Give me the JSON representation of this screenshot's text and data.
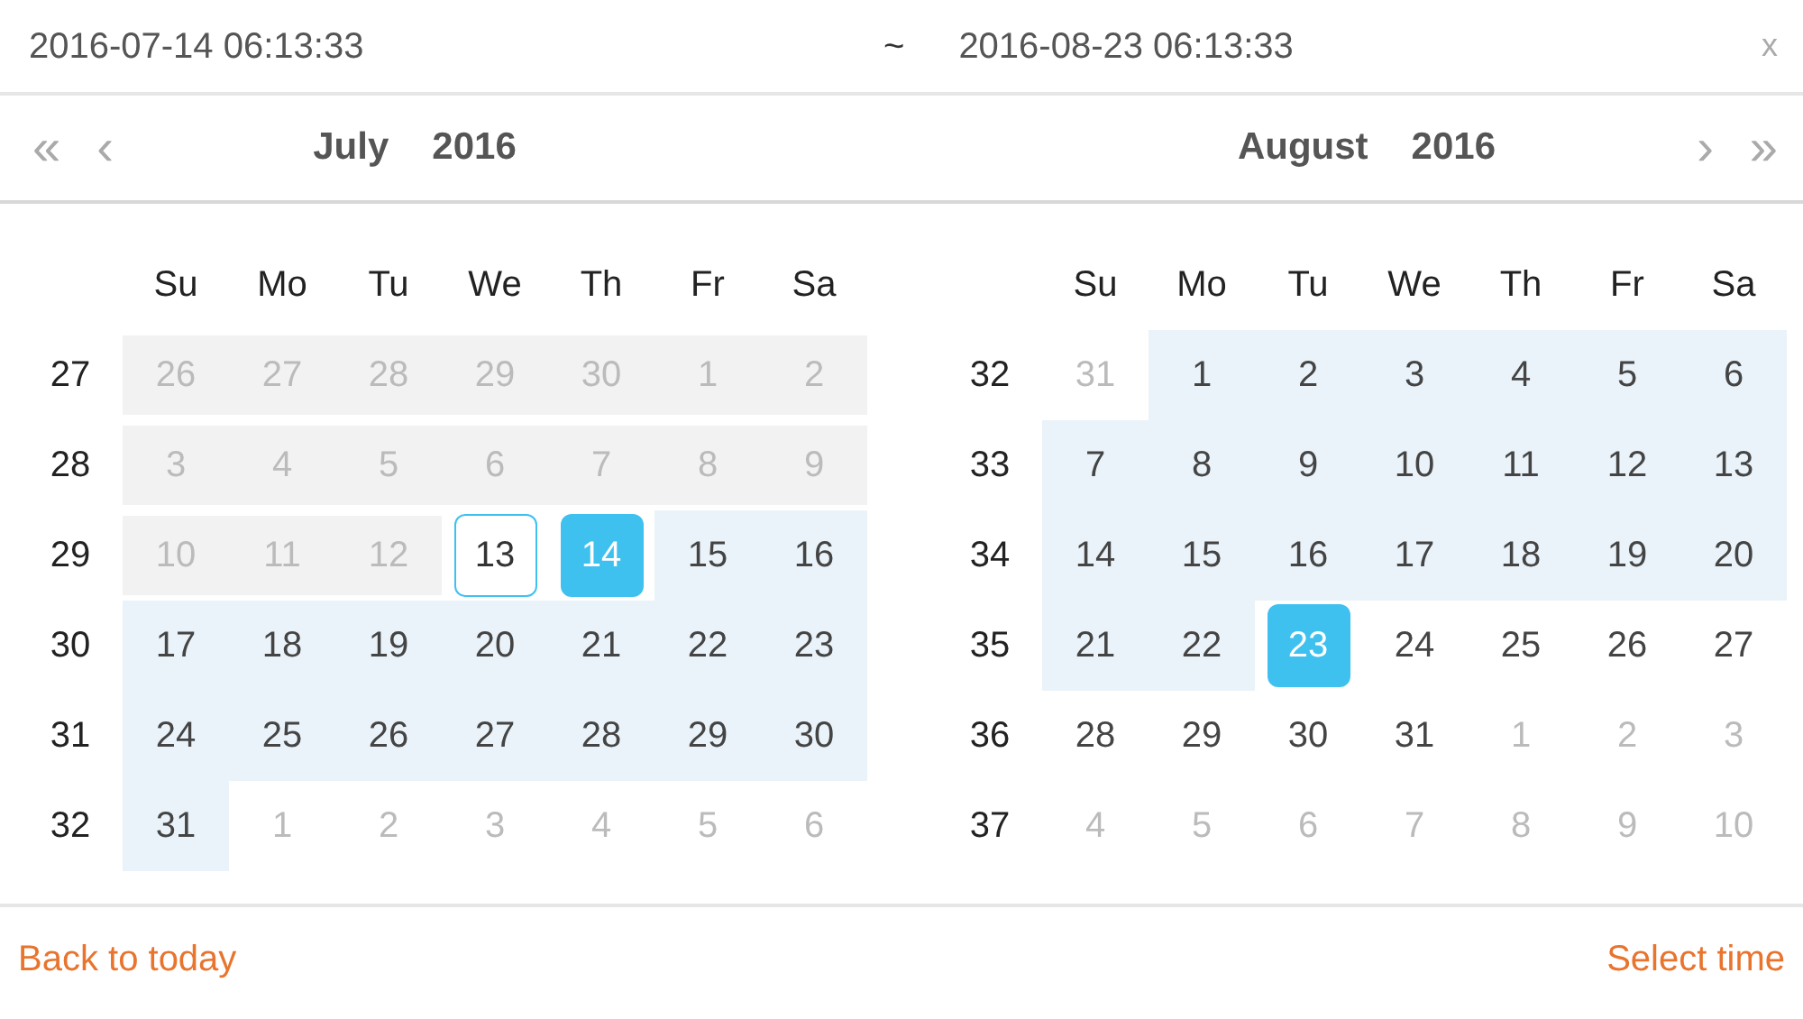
{
  "range": {
    "start": "2016-07-14 06:13:33",
    "separator": "~",
    "end": "2016-08-23 06:13:33",
    "close": "x"
  },
  "calendars": [
    {
      "nav": [
        {
          "label": "«",
          "kind": "prev-year"
        },
        {
          "label": "‹",
          "kind": "prev-month"
        }
      ],
      "month": "July",
      "year": "2016",
      "weekdays": [
        "Su",
        "Mo",
        "Tu",
        "We",
        "Th",
        "Fr",
        "Sa"
      ],
      "weeks": [
        {
          "number": "27",
          "days": [
            {
              "d": "26",
              "kind": "disabled",
              "in_range": false
            },
            {
              "d": "27",
              "kind": "disabled",
              "in_range": false
            },
            {
              "d": "28",
              "kind": "disabled",
              "in_range": false
            },
            {
              "d": "29",
              "kind": "disabled",
              "in_range": false
            },
            {
              "d": "30",
              "kind": "disabled",
              "in_range": false
            },
            {
              "d": "1",
              "kind": "disabled",
              "in_range": false
            },
            {
              "d": "2",
              "kind": "disabled",
              "in_range": false
            }
          ]
        },
        {
          "number": "28",
          "days": [
            {
              "d": "3",
              "kind": "disabled",
              "in_range": false
            },
            {
              "d": "4",
              "kind": "disabled",
              "in_range": false
            },
            {
              "d": "5",
              "kind": "disabled",
              "in_range": false
            },
            {
              "d": "6",
              "kind": "disabled",
              "in_range": false
            },
            {
              "d": "7",
              "kind": "disabled",
              "in_range": false
            },
            {
              "d": "8",
              "kind": "disabled",
              "in_range": false
            },
            {
              "d": "9",
              "kind": "disabled",
              "in_range": false
            }
          ]
        },
        {
          "number": "29",
          "days": [
            {
              "d": "10",
              "kind": "disabled",
              "in_range": false
            },
            {
              "d": "11",
              "kind": "disabled",
              "in_range": false
            },
            {
              "d": "12",
              "kind": "disabled",
              "in_range": false
            },
            {
              "d": "13",
              "kind": "today",
              "in_range": false
            },
            {
              "d": "14",
              "kind": "selected",
              "in_range": false
            },
            {
              "d": "15",
              "kind": "current",
              "in_range": true
            },
            {
              "d": "16",
              "kind": "current",
              "in_range": true
            }
          ]
        },
        {
          "number": "30",
          "days": [
            {
              "d": "17",
              "kind": "current",
              "in_range": true
            },
            {
              "d": "18",
              "kind": "current",
              "in_range": true
            },
            {
              "d": "19",
              "kind": "current",
              "in_range": true
            },
            {
              "d": "20",
              "kind": "current",
              "in_range": true
            },
            {
              "d": "21",
              "kind": "current",
              "in_range": true
            },
            {
              "d": "22",
              "kind": "current",
              "in_range": true
            },
            {
              "d": "23",
              "kind": "current",
              "in_range": true
            }
          ]
        },
        {
          "number": "31",
          "days": [
            {
              "d": "24",
              "kind": "current",
              "in_range": true
            },
            {
              "d": "25",
              "kind": "current",
              "in_range": true
            },
            {
              "d": "26",
              "kind": "current",
              "in_range": true
            },
            {
              "d": "27",
              "kind": "current",
              "in_range": true
            },
            {
              "d": "28",
              "kind": "current",
              "in_range": true
            },
            {
              "d": "29",
              "kind": "current",
              "in_range": true
            },
            {
              "d": "30",
              "kind": "current",
              "in_range": true
            }
          ]
        },
        {
          "number": "32",
          "days": [
            {
              "d": "31",
              "kind": "current",
              "in_range": true
            },
            {
              "d": "1",
              "kind": "other",
              "in_range": false
            },
            {
              "d": "2",
              "kind": "other",
              "in_range": false
            },
            {
              "d": "3",
              "kind": "other",
              "in_range": false
            },
            {
              "d": "4",
              "kind": "other",
              "in_range": false
            },
            {
              "d": "5",
              "kind": "other",
              "in_range": false
            },
            {
              "d": "6",
              "kind": "other",
              "in_range": false
            }
          ]
        }
      ]
    },
    {
      "nav": [
        {
          "label": "›",
          "kind": "next-month"
        },
        {
          "label": "»",
          "kind": "next-year"
        }
      ],
      "month": "August",
      "year": "2016",
      "weekdays": [
        "Su",
        "Mo",
        "Tu",
        "We",
        "Th",
        "Fr",
        "Sa"
      ],
      "weeks": [
        {
          "number": "32",
          "days": [
            {
              "d": "31",
              "kind": "other",
              "in_range": false
            },
            {
              "d": "1",
              "kind": "current",
              "in_range": true
            },
            {
              "d": "2",
              "kind": "current",
              "in_range": true
            },
            {
              "d": "3",
              "kind": "current",
              "in_range": true
            },
            {
              "d": "4",
              "kind": "current",
              "in_range": true
            },
            {
              "d": "5",
              "kind": "current",
              "in_range": true
            },
            {
              "d": "6",
              "kind": "current",
              "in_range": true
            }
          ]
        },
        {
          "number": "33",
          "days": [
            {
              "d": "7",
              "kind": "current",
              "in_range": true
            },
            {
              "d": "8",
              "kind": "current",
              "in_range": true
            },
            {
              "d": "9",
              "kind": "current",
              "in_range": true
            },
            {
              "d": "10",
              "kind": "current",
              "in_range": true
            },
            {
              "d": "11",
              "kind": "current",
              "in_range": true
            },
            {
              "d": "12",
              "kind": "current",
              "in_range": true
            },
            {
              "d": "13",
              "kind": "current",
              "in_range": true
            }
          ]
        },
        {
          "number": "34",
          "days": [
            {
              "d": "14",
              "kind": "current",
              "in_range": true
            },
            {
              "d": "15",
              "kind": "current",
              "in_range": true
            },
            {
              "d": "16",
              "kind": "current",
              "in_range": true
            },
            {
              "d": "17",
              "kind": "current",
              "in_range": true
            },
            {
              "d": "18",
              "kind": "current",
              "in_range": true
            },
            {
              "d": "19",
              "kind": "current",
              "in_range": true
            },
            {
              "d": "20",
              "kind": "current",
              "in_range": true
            }
          ]
        },
        {
          "number": "35",
          "days": [
            {
              "d": "21",
              "kind": "current",
              "in_range": true
            },
            {
              "d": "22",
              "kind": "current",
              "in_range": true
            },
            {
              "d": "23",
              "kind": "selected",
              "in_range": false
            },
            {
              "d": "24",
              "kind": "current",
              "in_range": false
            },
            {
              "d": "25",
              "kind": "current",
              "in_range": false
            },
            {
              "d": "26",
              "kind": "current",
              "in_range": false
            },
            {
              "d": "27",
              "kind": "current",
              "in_range": false
            }
          ]
        },
        {
          "number": "36",
          "days": [
            {
              "d": "28",
              "kind": "current",
              "in_range": false
            },
            {
              "d": "29",
              "kind": "current",
              "in_range": false
            },
            {
              "d": "30",
              "kind": "current",
              "in_range": false
            },
            {
              "d": "31",
              "kind": "current",
              "in_range": false
            },
            {
              "d": "1",
              "kind": "other",
              "in_range": false
            },
            {
              "d": "2",
              "kind": "other",
              "in_range": false
            },
            {
              "d": "3",
              "kind": "other",
              "in_range": false
            }
          ]
        },
        {
          "number": "37",
          "days": [
            {
              "d": "4",
              "kind": "other",
              "in_range": false
            },
            {
              "d": "5",
              "kind": "other",
              "in_range": false
            },
            {
              "d": "6",
              "kind": "other",
              "in_range": false
            },
            {
              "d": "7",
              "kind": "other",
              "in_range": false
            },
            {
              "d": "8",
              "kind": "other",
              "in_range": false
            },
            {
              "d": "9",
              "kind": "other",
              "in_range": false
            },
            {
              "d": "10",
              "kind": "other",
              "in_range": false
            }
          ]
        }
      ]
    }
  ],
  "footer": {
    "today": "Back to today",
    "confirm": "Select time"
  }
}
